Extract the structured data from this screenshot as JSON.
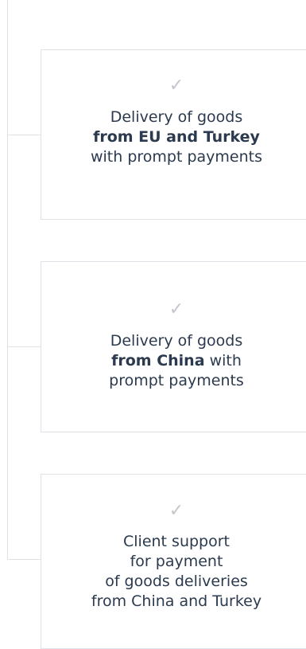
{
  "cards": [
    {
      "check": "✓",
      "line1": "Delivery of goods",
      "line2_bold": "from EU and Turkey",
      "line3": "with prompt payments"
    },
    {
      "check": "✓",
      "line1": "Delivery of goods",
      "line2_bold": "from China",
      "line2_rest": " with",
      "line3": "prompt payments"
    },
    {
      "check": "✓",
      "line1": "Client support",
      "line2": "for payment",
      "line3": "of goods deliveries",
      "line4": "from China and Turkey"
    }
  ]
}
